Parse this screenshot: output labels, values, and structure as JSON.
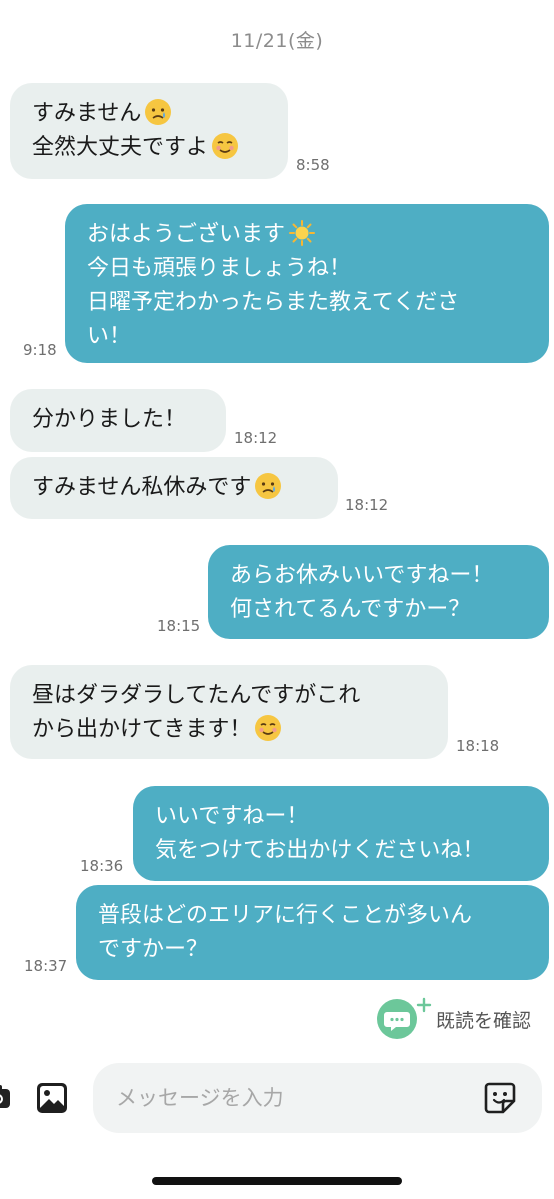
{
  "chat": {
    "date_header": "11/21(金)",
    "messages": [
      {
        "direction": "in",
        "lines": [
          "すみません",
          "全然大丈夫ですよ"
        ],
        "emojis": [
          "crying-face",
          "smiling-face"
        ],
        "time": "8:58"
      },
      {
        "direction": "out",
        "lines": [
          "おはようございます",
          "今日も頑張りましょうね！",
          "日曜予定わかったらまた教えてくださ",
          "い！"
        ],
        "emojis": [
          "sun"
        ],
        "time": "9:18"
      },
      {
        "direction": "in",
        "lines": [
          "分かりました！"
        ],
        "time": "18:12"
      },
      {
        "direction": "in",
        "lines": [
          "すみません私休みです"
        ],
        "emojis": [
          "crying-face"
        ],
        "time": "18:12"
      },
      {
        "direction": "out",
        "lines": [
          "あらお休みいいですねー！",
          "何されてるんですかー？"
        ],
        "time": "18:15"
      },
      {
        "direction": "in",
        "lines": [
          "昼はダラダラしてたんですがこれ",
          "から出かけてきます！"
        ],
        "emojis": [
          "smiling-face"
        ],
        "time": "18:18"
      },
      {
        "direction": "out",
        "lines": [
          "いいですねー！",
          "気をつけてお出かけくださいね！"
        ],
        "time": "18:36"
      },
      {
        "direction": "out",
        "lines": [
          "普段はどのエリアに行くことが多いん",
          "ですかー？"
        ],
        "time": "18:37"
      }
    ],
    "read_receipt": {
      "label": "既読を確認",
      "icon": "chat-bubble-check-icon"
    }
  },
  "composer": {
    "placeholder": "メッセージを入力",
    "icons": [
      "camera-icon",
      "gallery-icon",
      "sticker-icon"
    ]
  },
  "colors": {
    "outgoing_bubble": "#4eaec4",
    "incoming_bubble": "#e9efee",
    "read_icon": "#6cc79a"
  }
}
